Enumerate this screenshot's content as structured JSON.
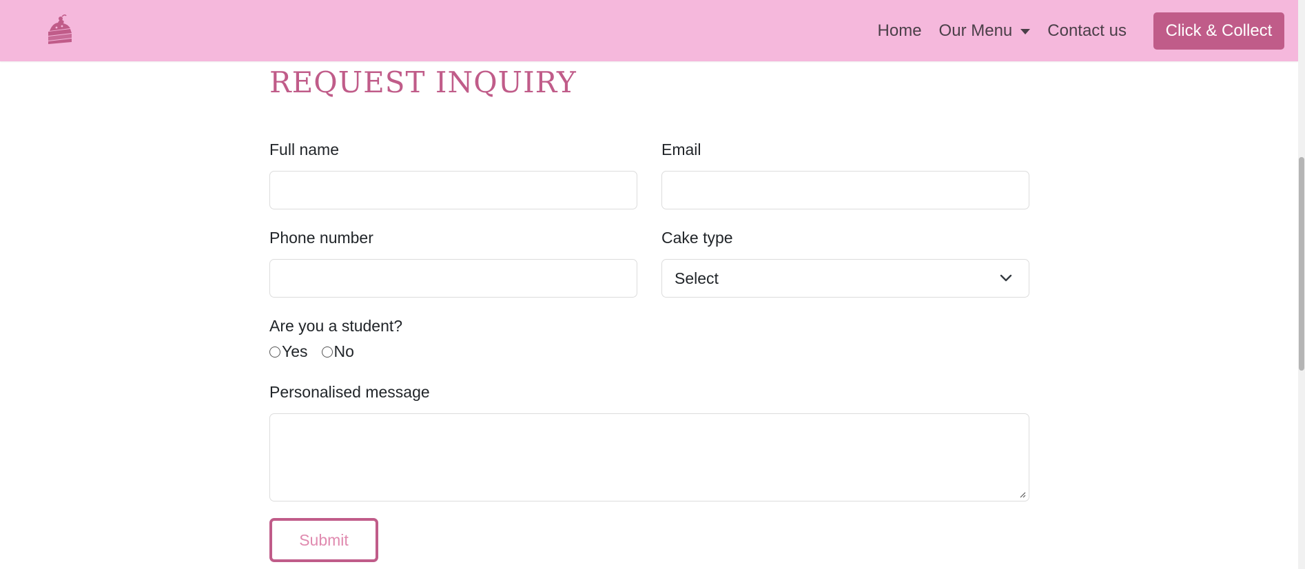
{
  "navbar": {
    "logo_icon": "cake-slice-icon",
    "links": [
      {
        "label": "Home"
      },
      {
        "label": "Our Menu",
        "has_dropdown": true
      },
      {
        "label": "Contact us"
      }
    ],
    "cta_label": "Click & Collect"
  },
  "form": {
    "title": "REQUEST INQUIRY",
    "full_name_label": "Full name",
    "full_name_value": "",
    "email_label": "Email",
    "email_value": "",
    "phone_label": "Phone number",
    "phone_value": "",
    "cake_type_label": "Cake type",
    "cake_type_value": "Select",
    "student_label": "Are you a student?",
    "student_options": [
      "Yes",
      "No"
    ],
    "message_label": "Personalised message",
    "message_value": "",
    "submit_label": "Submit"
  },
  "colors": {
    "navbar_bg": "#f5b8dc",
    "accent": "#c05c89",
    "submit_text": "#e08aaf"
  }
}
